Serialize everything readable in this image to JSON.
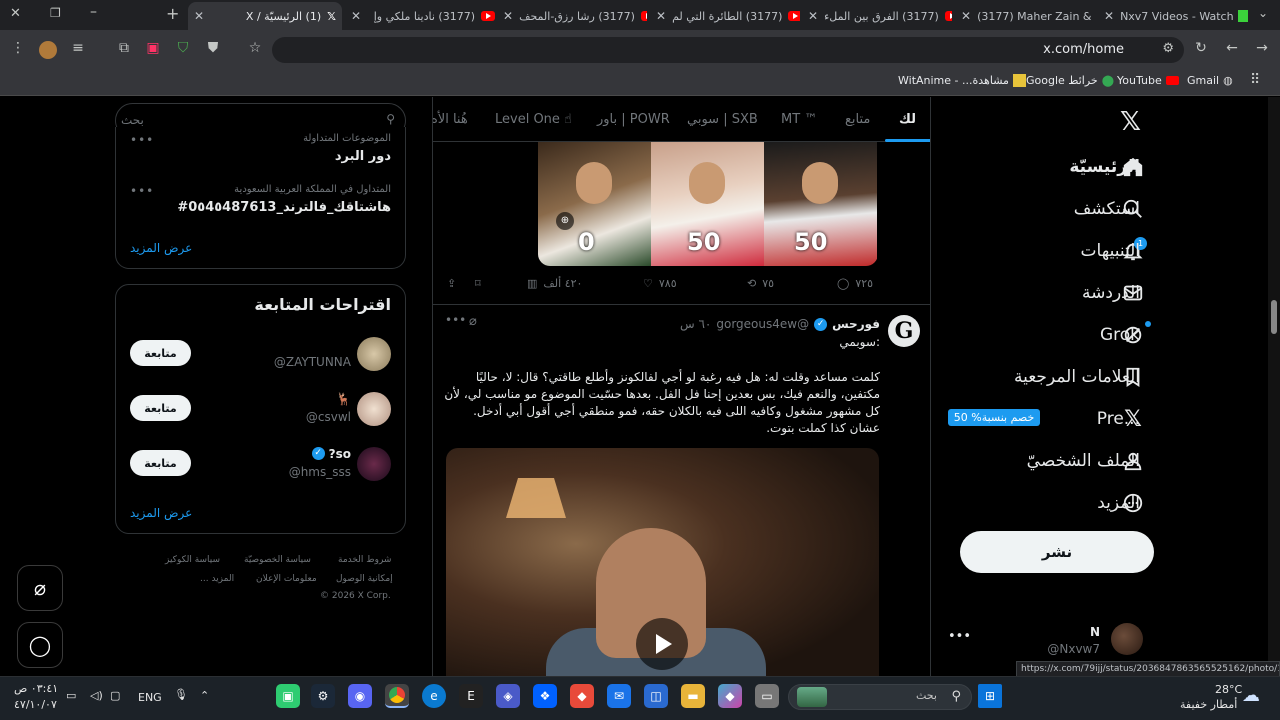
{
  "browser": {
    "tabs": [
      {
        "title": "Nxv7 Videos - Watch"
      },
      {
        "title": "(3177) Maher Zain &"
      },
      {
        "title": "(3177) الفرق بين الملء"
      },
      {
        "title": "(3177) الطائرة التي لم"
      },
      {
        "title": "(3177) رشا رزق-المحف"
      },
      {
        "title": "(3177) نادينا ملكي وإ"
      },
      {
        "title": "(1) الرئيسيّة / X"
      }
    ],
    "url": "x.com/home",
    "bookmarks": [
      {
        "label": "Gmail"
      },
      {
        "label": "YouTube"
      },
      {
        "label": "خرائط Google"
      },
      {
        "label": "مشاهدة... - WitAnime"
      }
    ],
    "status_url": "https://x.com/79ijj/status/2036847863565525162/photo/1"
  },
  "nav": {
    "items": [
      {
        "label": "الرئيسيّة",
        "icon": "home-icon"
      },
      {
        "label": "استكشف",
        "icon": "search-icon"
      },
      {
        "label": "التنبيهات",
        "icon": "bell-icon",
        "badge": "1"
      },
      {
        "label": "الدردشة",
        "icon": "mail-icon"
      },
      {
        "label": "Grok",
        "icon": "grok-icon"
      },
      {
        "label": "العلامات المرجعية",
        "icon": "bookmark-icon"
      },
      {
        "label": "Pre...",
        "icon": "x-logo-icon",
        "badge": "50 %خصم بنسبة"
      },
      {
        "label": "الملف الشخصيّ",
        "icon": "profile-icon"
      },
      {
        "label": "المزيد",
        "icon": "more-icon"
      }
    ],
    "post_label": "نشر",
    "account": {
      "name": "N",
      "handle": "@Nxvw7"
    }
  },
  "feed": {
    "tabs": [
      "لك",
      "متابع",
      "MT ™",
      "سوبي | SXB",
      "باور | POWR",
      "Level One ☝",
      "هُنا الأه"
    ],
    "tweet1": {
      "prices": [
        "50",
        "50",
        "0"
      ],
      "actions": {
        "replies": "٧٢٥",
        "reposts": "٧٥",
        "likes": "٧٨٥",
        "views": "٤٢٠ ألف"
      }
    },
    "tweet2": {
      "avatar_letter": "G",
      "name": "فورحس",
      "handle": "@gorgeous4ew",
      "time": "٦٠ س",
      "subtitle": "سوبمي:",
      "body": "كلمت مساعد وقلت له: هل فيه رغبة لو أجي لفالكونز وأطلع طاقتي؟ قال: لا، حاليًا مكتفين، والنعم فيك، بس بعدين إحنا فل الفل. بعدها حسّيت الموضوع مو مناسب لي، لأن كل مشهور مشغول وكافيه اللى فيه بالكلان حقه، فمو منطقي أجي أقول أبي أدخل. عشان كذا كملت بتوت."
    }
  },
  "sidebar": {
    "search_placeholder": "بحث",
    "trends": [
      {
        "meta": "الموضوعات المتداولة",
        "title": "دور البرد"
      },
      {
        "meta": "المتداول في المملكة العربية السعودية",
        "title": "#هاشتاقك_فالترند_0٥4٥487613"
      }
    ],
    "show_more": "عرض المزيد",
    "suggest_title": "اقتراحات المتابعة",
    "suggestions": [
      {
        "name": "",
        "handle": "@ZAYTUNNA",
        "follow": "متابعة"
      },
      {
        "name": "🦌",
        "handle": "@csvwl",
        "follow": "متابعة"
      },
      {
        "name": "so?",
        "handle": "@hms_sss",
        "follow": "متابعة"
      }
    ],
    "footer": [
      "شروط الخدمة",
      "سياسة الخصوصيّة",
      "سياسة الكوكيز",
      "إمكانية الوصول",
      "معلومات الإعلان",
      "... المزيد",
      "© 2026 X Corp."
    ]
  },
  "taskbar": {
    "search": "بحث",
    "weather": {
      "temp": "28°C",
      "desc": "أمطار خفيفة"
    },
    "lang": "ENG",
    "time": "٠٣:٤١ ص",
    "date": "٤٧/١٠/٠٧"
  },
  "colors": {
    "accent": "#1d9bf0",
    "bg": "#000000",
    "border": "#2f3336"
  }
}
